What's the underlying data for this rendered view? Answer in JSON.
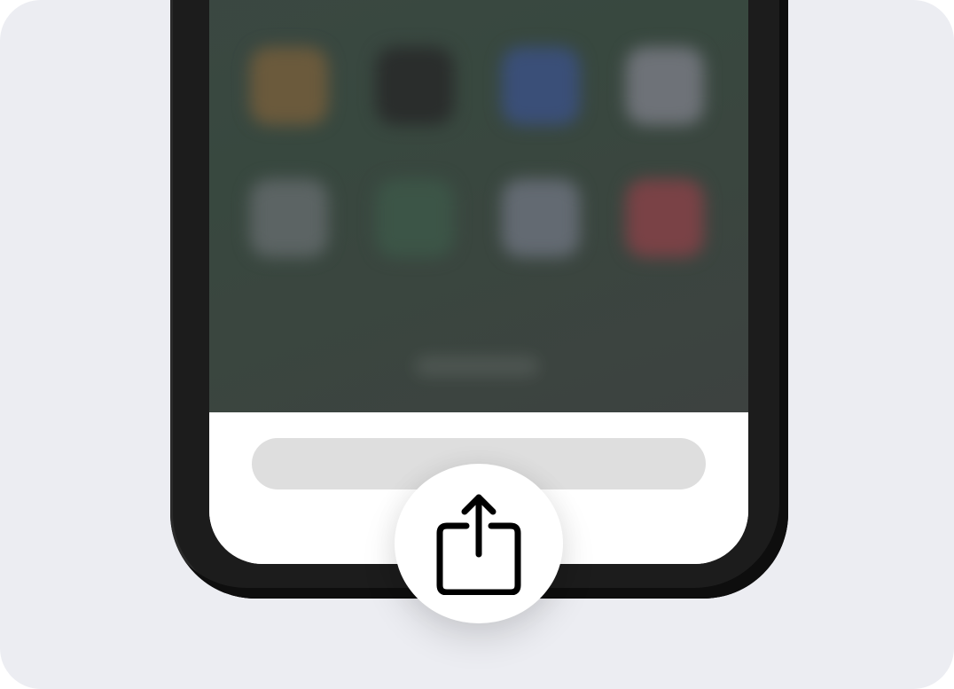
{
  "colors": {
    "background": "#ecedf2",
    "phone_frame": "#1c1c1c",
    "wallpaper": "#3a473f",
    "url_bar": "#dedede",
    "share_button": "#ffffff",
    "icon_stroke": "#000000"
  },
  "home_screen": {
    "blurred": true,
    "app_icons": [
      {
        "icon": "app-icon-orange",
        "color": "#6b5a3c"
      },
      {
        "icon": "app-icon-dark",
        "color": "#2a2d2c"
      },
      {
        "icon": "app-icon-blue",
        "color": "#3a4f78"
      },
      {
        "icon": "app-icon-white",
        "color": "#6e7278"
      },
      {
        "icon": "app-icon-gray",
        "color": "#5c6464"
      },
      {
        "icon": "app-icon-green",
        "color": "#3c5547"
      },
      {
        "icon": "app-icon-light",
        "color": "#636a72"
      },
      {
        "icon": "app-icon-red",
        "color": "#7a4246"
      }
    ]
  },
  "browser": {
    "url_bar_text": ""
  },
  "share_button": {
    "icon": "share-icon"
  }
}
